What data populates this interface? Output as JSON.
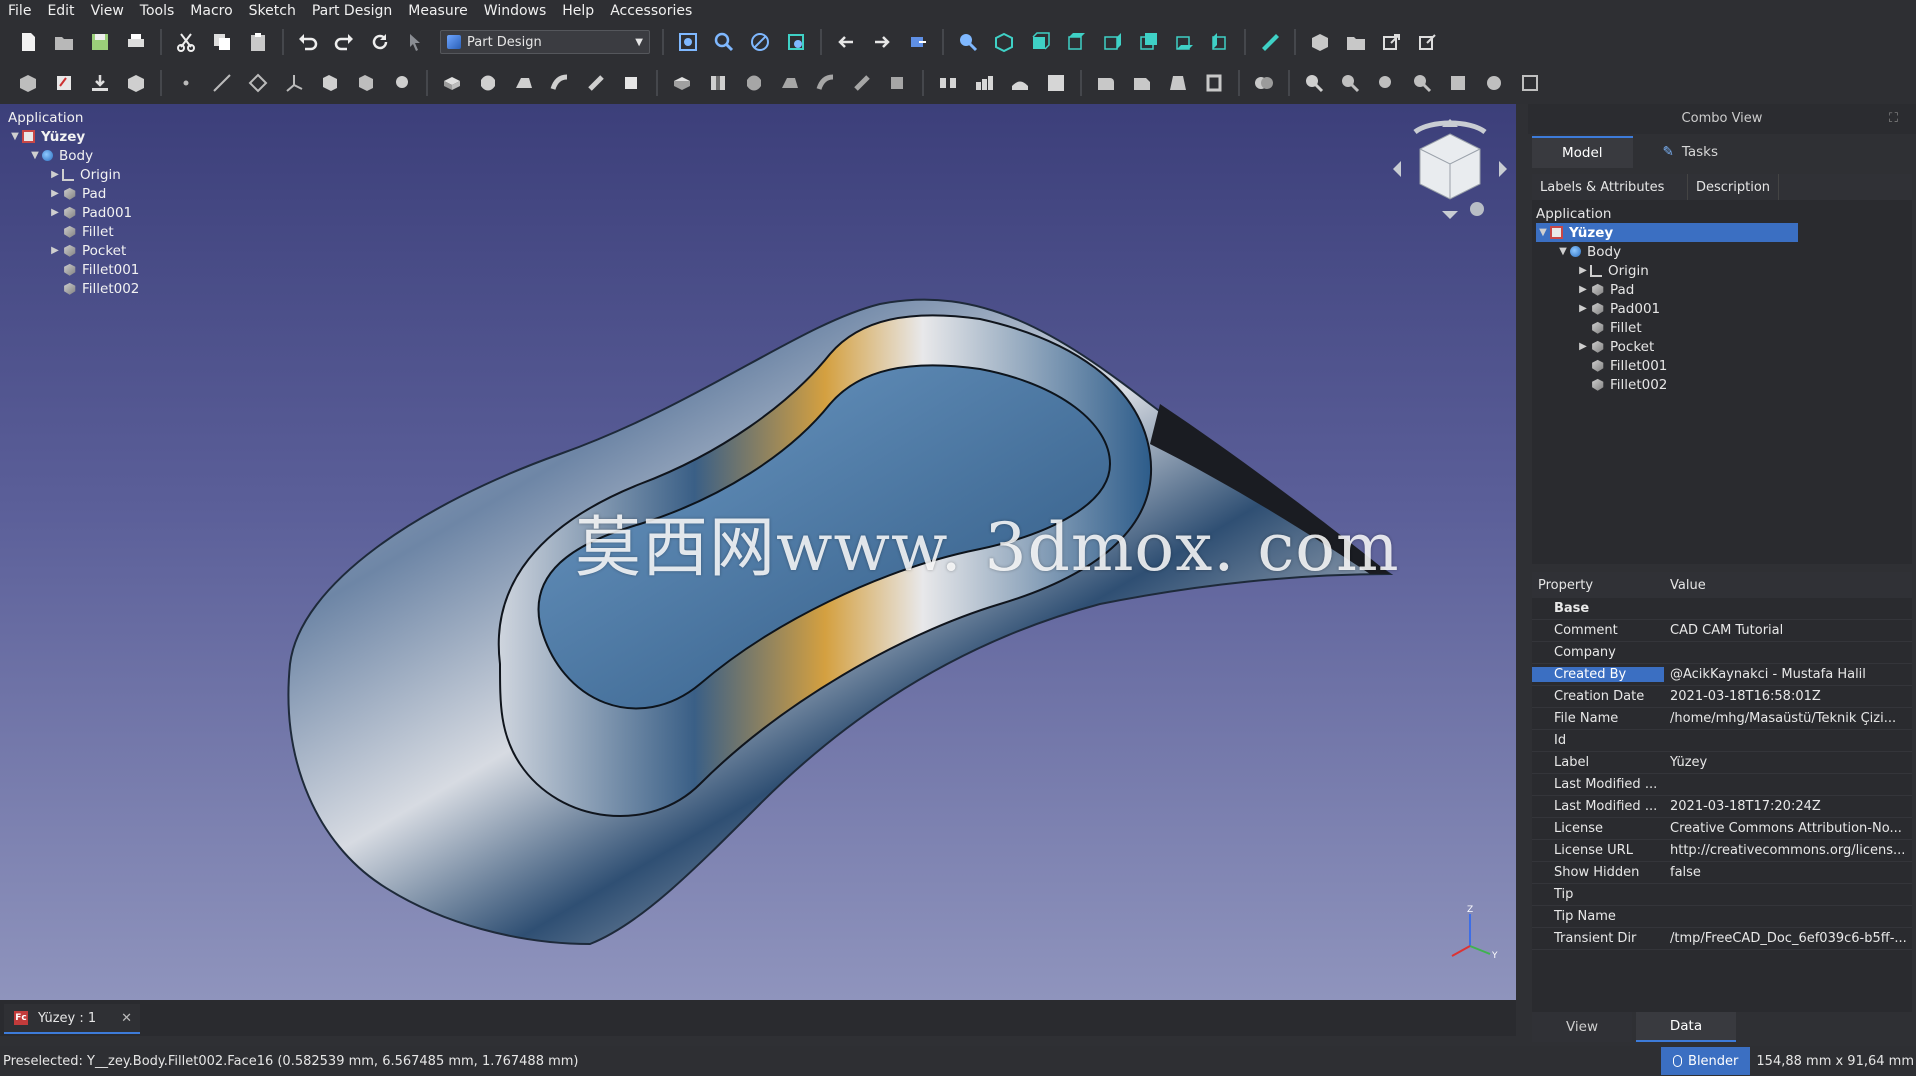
{
  "menu": [
    "File",
    "Edit",
    "View",
    "Tools",
    "Macro",
    "Sketch",
    "Part Design",
    "Measure",
    "Windows",
    "Help",
    "Accessories"
  ],
  "workbench": "Part Design",
  "viewport_tree": {
    "header": "Application",
    "doc": "Yüzey",
    "body": "Body",
    "items": [
      "Origin",
      "Pad",
      "Pad001",
      "Fillet",
      "Pocket",
      "Fillet001",
      "Fillet002"
    ]
  },
  "watermark": "莫西网www. 3dmox. com",
  "doc_tab": "Yüzey : 1",
  "status_text": "Preselected: Y__zey.Body.Fillet002.Face16 (0.582539 mm, 6.567485 mm, 1.767488 mm)",
  "status_nav": "Blender",
  "status_dims": "154,88 mm x 91,64 mm",
  "combo": {
    "title": "Combo View",
    "tabs": [
      "Model",
      "Tasks"
    ],
    "tree_headers": [
      "Labels & Attributes",
      "Description"
    ],
    "tree_root": "Application",
    "doc": "Yüzey",
    "body": "Body",
    "items": [
      "Origin",
      "Pad",
      "Pad001",
      "Fillet",
      "Pocket",
      "Fillet001",
      "Fillet002"
    ],
    "prop_headers": [
      "Property",
      "Value"
    ],
    "group": "Base",
    "properties": [
      {
        "name": "Comment",
        "value": "CAD CAM Tutorial"
      },
      {
        "name": "Company",
        "value": ""
      },
      {
        "name": "Created By",
        "value": "@AcikKaynakci - Mustafa Halil"
      },
      {
        "name": "Creation Date",
        "value": "2021-03-18T16:58:01Z"
      },
      {
        "name": "File Name",
        "value": "/home/mhg/Masaüstü/Teknik Çizi..."
      },
      {
        "name": "Id",
        "value": ""
      },
      {
        "name": "Label",
        "value": "Yüzey"
      },
      {
        "name": "Last Modified ...",
        "value": ""
      },
      {
        "name": "Last Modified ...",
        "value": "2021-03-18T17:20:24Z"
      },
      {
        "name": "License",
        "value": "Creative Commons Attribution-No..."
      },
      {
        "name": "License URL",
        "value": "http://creativecommons.org/licens..."
      },
      {
        "name": "Show Hidden",
        "value": "false"
      },
      {
        "name": "Tip",
        "value": ""
      },
      {
        "name": "Tip Name",
        "value": ""
      },
      {
        "name": "Transient Dir",
        "value": "/tmp/FreeCAD_Doc_6ef039c6-b5ff-..."
      }
    ],
    "bottom_tabs": [
      "View",
      "Data"
    ]
  }
}
